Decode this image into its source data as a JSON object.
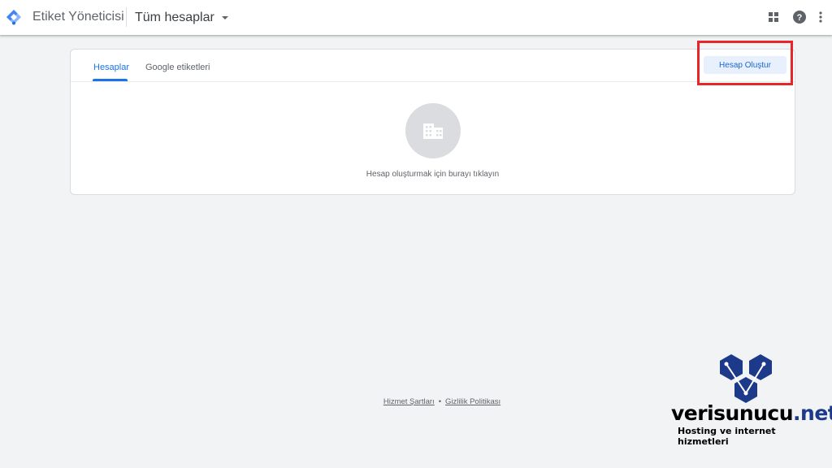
{
  "header": {
    "product_name": "Etiket Yöneticisi",
    "account_selector": "Tüm hesaplar",
    "icons": [
      "apps-grid-icon",
      "help-icon",
      "more-vert-icon"
    ]
  },
  "tabs": [
    {
      "label": "Hesaplar",
      "active": true
    },
    {
      "label": "Google etiketleri",
      "active": false
    }
  ],
  "actions": {
    "create_account_label": "Hesap Oluştur"
  },
  "empty_state": {
    "icon": "building-icon",
    "message": "Hesap oluşturmak için burayı tıklayın"
  },
  "footer": {
    "terms": "Hizmet Şartları",
    "separator": "•",
    "privacy": "Gizlilik Politikası"
  },
  "watermark": {
    "brand_main": "verisunucu",
    "brand_tld": ".net",
    "tagline": "Hosting ve internet hizmetleri"
  },
  "colors": {
    "accent": "#1a73e8",
    "button_bg": "#e8f0fe",
    "highlight": "#e8262a",
    "brand": "#1d3a8a"
  }
}
